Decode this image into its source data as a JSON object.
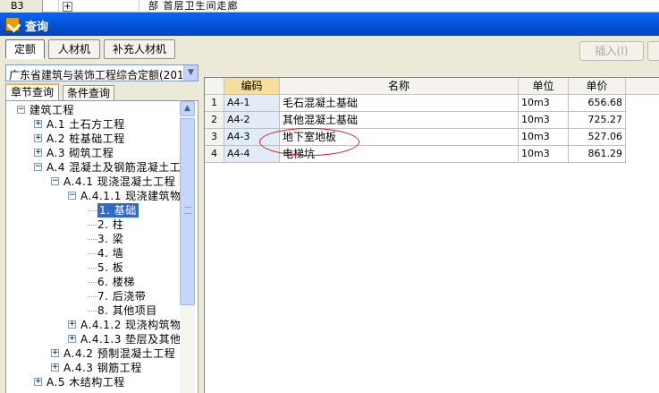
{
  "background_sheet": {
    "row_ref": "B3",
    "text": "部 首层卫生间走廊"
  },
  "dialog": {
    "title": "查询",
    "tabs": [
      {
        "label": "定额",
        "active": true
      },
      {
        "label": "人材机",
        "active": false
      },
      {
        "label": "补充人材机",
        "active": false
      }
    ],
    "insert_button": "插入(I)"
  },
  "left_panel": {
    "quota_library": "广东省建筑与装饰工程综合定额(201",
    "subtabs": [
      {
        "label": "章节查询",
        "active": true
      },
      {
        "label": "条件查询",
        "active": false
      }
    ],
    "tree": [
      {
        "label": "建筑工程",
        "expander": "−"
      },
      {
        "label": "A.1 土石方工程",
        "expander": "+"
      },
      {
        "label": "A.2 桩基础工程",
        "expander": "+"
      },
      {
        "label": "A.3 砌筑工程",
        "expander": "+"
      },
      {
        "label": "A.4 混凝土及钢筋混凝土工",
        "expander": "−"
      },
      {
        "label": "A.4.1 现浇混凝土工程",
        "expander": "−"
      },
      {
        "label": "A.4.1.1 现浇建筑物",
        "expander": "−"
      },
      {
        "label": "1. 基础",
        "selected": true
      },
      {
        "label": "2. 柱"
      },
      {
        "label": "3. 梁"
      },
      {
        "label": "4. 墙"
      },
      {
        "label": "5. 板"
      },
      {
        "label": "6. 楼梯"
      },
      {
        "label": "7. 后浇带"
      },
      {
        "label": "8. 其他项目"
      },
      {
        "label": "A.4.1.2 现浇构筑物",
        "expander": "+"
      },
      {
        "label": "A.4.1.3 垫层及其他",
        "expander": "+"
      },
      {
        "label": "A.4.2 预制混凝土工程",
        "expander": "+"
      },
      {
        "label": "A.4.3 钢筋工程",
        "expander": "+"
      },
      {
        "label": "A.5 木结构工程",
        "expander": "+"
      }
    ]
  },
  "grid": {
    "headers": [
      "编码",
      "名称",
      "单位",
      "单价"
    ],
    "rows": [
      {
        "no": "1",
        "code": "A4-1",
        "name": "毛石混凝土基础",
        "unit": "10m3",
        "price": "656.68"
      },
      {
        "no": "2",
        "code": "A4-2",
        "name": "其他混凝土基础",
        "unit": "10m3",
        "price": "725.27"
      },
      {
        "no": "3",
        "code": "A4-3",
        "name": "地下室地板",
        "unit": "10m3",
        "price": "527.06"
      },
      {
        "no": "4",
        "code": "A4-4",
        "name": "电梯坑",
        "unit": "10m3",
        "price": "861.29"
      }
    ]
  },
  "colors": {
    "titlebar": "#0553d6",
    "selection": "#316ac5",
    "header_highlight": "#f6df9c",
    "annotation": "#c32020"
  }
}
